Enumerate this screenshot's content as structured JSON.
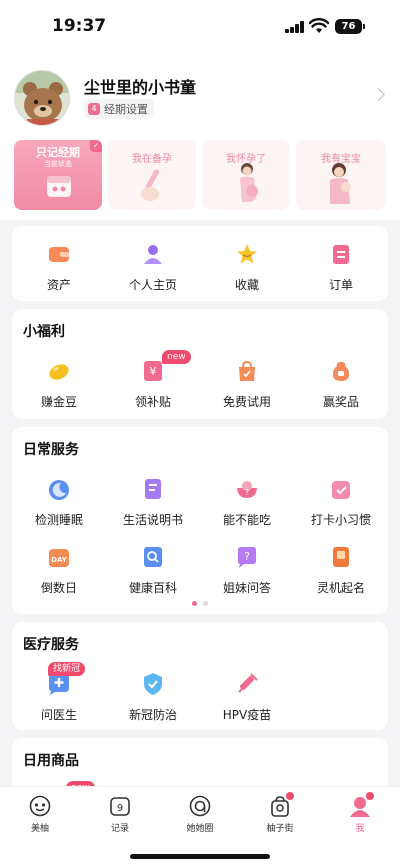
{
  "status": {
    "time": "19:37",
    "battery": "76"
  },
  "profile": {
    "username": "尘世里的小书童",
    "period_badge": "4",
    "period_label": "经期设置"
  },
  "modes": [
    {
      "label": "只记经期",
      "sub": "当前状态",
      "active": true
    },
    {
      "label": "我在备孕",
      "active": false
    },
    {
      "label": "我怀孕了",
      "active": false
    },
    {
      "label": "我有宝宝",
      "active": false
    }
  ],
  "quick": [
    {
      "label": "资产",
      "icon": "wallet-icon"
    },
    {
      "label": "个人主页",
      "icon": "person-icon"
    },
    {
      "label": "收藏",
      "icon": "star-icon"
    },
    {
      "label": "订单",
      "icon": "order-icon"
    }
  ],
  "welfare": {
    "title": "小福利",
    "items": [
      {
        "label": "赚金豆",
        "icon": "gold-bean-icon"
      },
      {
        "label": "领补贴",
        "icon": "subsidy-icon",
        "tag": "new"
      },
      {
        "label": "免费试用",
        "icon": "free-trial-bag-icon"
      },
      {
        "label": "赢奖品",
        "icon": "prize-bag-icon"
      }
    ]
  },
  "daily": {
    "title": "日常服务",
    "items": [
      {
        "label": "检测睡眠",
        "icon": "sleep-moon-icon"
      },
      {
        "label": "生活说明书",
        "icon": "manual-icon"
      },
      {
        "label": "能不能吃",
        "icon": "food-bowl-icon"
      },
      {
        "label": "打卡小习惯",
        "icon": "check-in-icon"
      },
      {
        "label": "倒数日",
        "icon": "countdown-day-icon",
        "icon_text": "DAY"
      },
      {
        "label": "健康百科",
        "icon": "encyclopedia-icon"
      },
      {
        "label": "姐妹问答",
        "icon": "question-bubble-icon"
      },
      {
        "label": "灵机起名",
        "icon": "naming-book-icon"
      }
    ]
  },
  "medical": {
    "title": "医疗服务",
    "items": [
      {
        "label": "问医生",
        "icon": "doctor-chat-icon",
        "tag": "找新冠"
      },
      {
        "label": "新冠防治",
        "icon": "shield-icon"
      },
      {
        "label": "HPV疫苗",
        "icon": "vaccine-icon"
      }
    ]
  },
  "goods": {
    "title": "日用商品",
    "tag": "new"
  },
  "tabs": [
    {
      "label": "美柚",
      "icon": "meiyou-icon"
    },
    {
      "label": "记录",
      "icon": "calendar-icon",
      "icon_text": "9"
    },
    {
      "label": "她她圈",
      "icon": "circle-community-icon"
    },
    {
      "label": "柚子街",
      "icon": "shopping-bag-icon",
      "dot": true
    },
    {
      "label": "我",
      "icon": "me-icon",
      "active": true,
      "dot": true
    }
  ],
  "colors": {
    "accent": "#f06b8f",
    "tag_red": "#f04a6e",
    "background": "#f4f4f6"
  }
}
